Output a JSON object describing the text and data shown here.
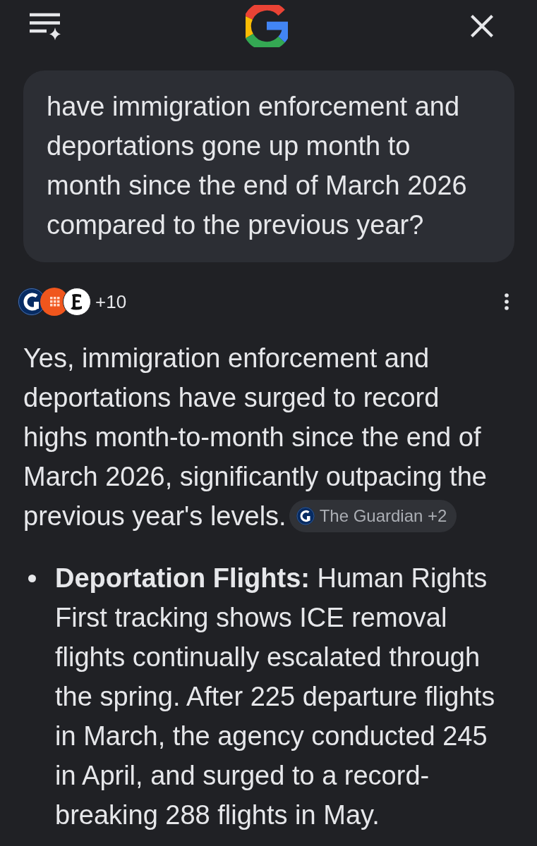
{
  "query": {
    "text": "have immigration enforcement and deportations gone up month to month since the end of March 2026 compared to the previous year?"
  },
  "sources": {
    "more_count": "+10"
  },
  "answer": {
    "text": "Yes, immigration enforcement and deportations have surged to record highs month-to-month since the end of March 2026, significantly outpacing the previous year's levels.",
    "citation": "The Guardian +2"
  },
  "bullets": [
    {
      "text": "**Deportation Flights:** Human Rights First tracking shows ICE removal flights continually escalated through the spring. After 225 departure flights in March, the agency conducted 245 in April, and surged to a record-breaking 288 flights in May."
    }
  ]
}
